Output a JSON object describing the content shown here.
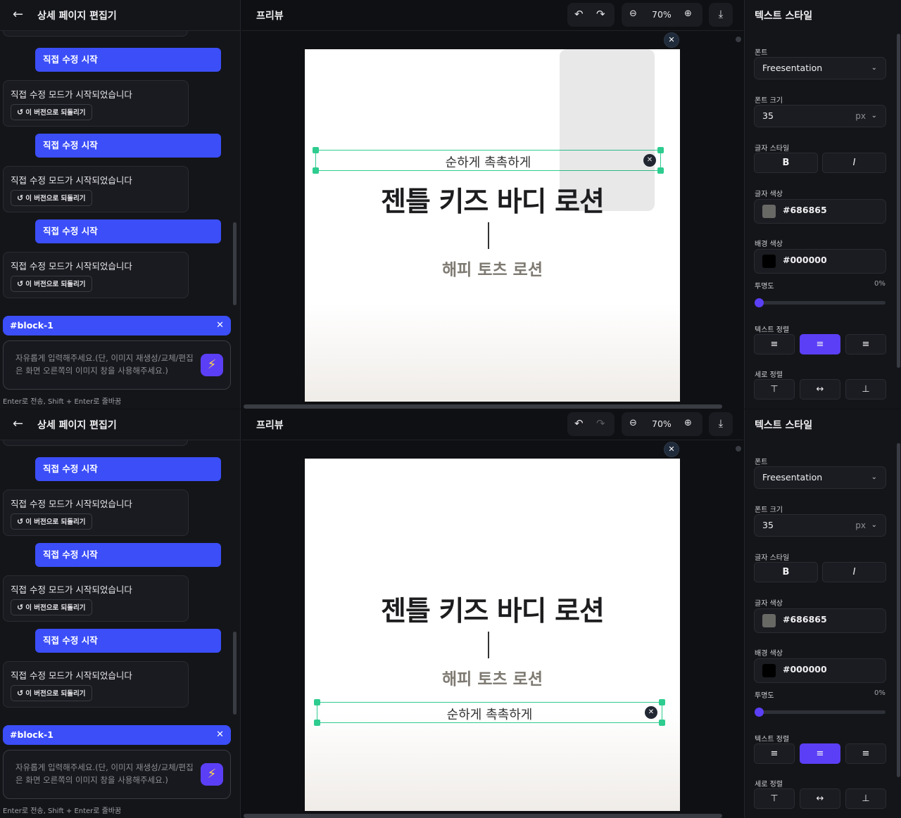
{
  "left": {
    "title": "상세 페이지 편집기",
    "user_message": "직접 수정 시작",
    "assistant_message": "직접 수정 모드가 시작되었습니다",
    "revert_label": "이 버전으로 되돌리기",
    "tag_label": "#block-1",
    "input_placeholder": "자유롭게 입력해주세요.(단, 이미지 재생성/교체/편집은 화면 오른쪽의 이미지 창을 사용해주세요.)",
    "hint": "Enter로 전송, Shift + Enter로 줄바꿈"
  },
  "preview": {
    "title": "프리뷰",
    "zoom": "70%",
    "selected_text": "순하게 촉촉하게",
    "headline": "젠틀 키즈 바디 로션",
    "subline": "해피 토츠 로션"
  },
  "style_panel": {
    "title": "텍스트 스타일",
    "font_label": "폰트",
    "font_value": "Freesentation",
    "size_label": "폰트 크기",
    "size_value": "35",
    "size_unit": "px",
    "weight_label": "글자 스타일",
    "bold": "B",
    "italic": "I",
    "color_label": "글자 색상",
    "color_value": "#686865",
    "bg_label": "배경 색상",
    "bg_value": "#000000",
    "opacity_label": "투명도",
    "opacity_value": "0%",
    "align_label": "텍스트 정렬",
    "valign_label": "세로 정렬"
  },
  "colors": {
    "accent": "#3b4ef8",
    "purple": "#5b3ff6",
    "selection": "#2ecc8f"
  },
  "icons": {
    "back": "arrow-left-icon",
    "send": "lightning-icon",
    "undo": "undo-icon",
    "redo": "redo-icon",
    "zoom_out": "zoom-out-icon",
    "zoom_in": "zoom-in-icon",
    "download": "download-icon",
    "revert": "rotate-ccw-icon"
  }
}
